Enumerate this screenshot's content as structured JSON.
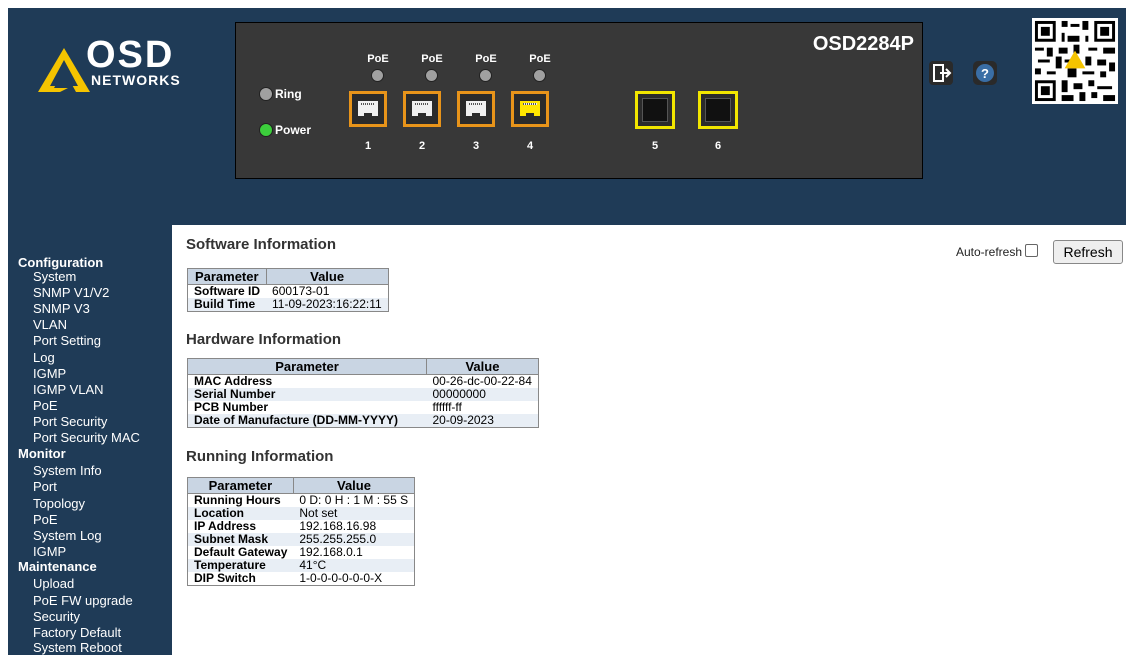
{
  "logo": {
    "main": "OSD",
    "sub": "NETWORKS"
  },
  "device": {
    "model": "OSD2284P",
    "leds": [
      {
        "label": "Ring",
        "state": "off",
        "color": "#a0a0a0"
      },
      {
        "label": "Power",
        "state": "on",
        "color": "#3ccf3c"
      }
    ],
    "poe_labels": [
      "PoE",
      "PoE",
      "PoE",
      "PoE"
    ],
    "ports": [
      {
        "number": "1",
        "type": "rj45",
        "link": false
      },
      {
        "number": "2",
        "type": "rj45",
        "link": false
      },
      {
        "number": "3",
        "type": "rj45",
        "link": false
      },
      {
        "number": "4",
        "type": "rj45",
        "link": true
      },
      {
        "number": "5",
        "type": "sfp",
        "link": false
      },
      {
        "number": "6",
        "type": "sfp",
        "link": false
      }
    ]
  },
  "header_icons": [
    "logout-icon",
    "help-icon",
    "qr-code-icon"
  ],
  "sidebar": {
    "groups": [
      {
        "title": "Configuration",
        "items": [
          "System",
          "SNMP V1/V2",
          "SNMP V3",
          "VLAN",
          "Port Setting",
          "Log",
          "IGMP",
          "IGMP VLAN",
          "PoE",
          "Port Security",
          "Port Security MAC"
        ]
      },
      {
        "title": "Monitor",
        "items": [
          "System Info",
          "Port",
          "Topology",
          "PoE",
          "System Log",
          "IGMP"
        ]
      },
      {
        "title": "Maintenance",
        "items": [
          "Upload",
          "PoE FW upgrade",
          "Security",
          "Factory Default",
          "System Reboot"
        ]
      }
    ]
  },
  "controls": {
    "auto_refresh_label": "Auto-refresh",
    "auto_refresh_checked": false,
    "refresh_label": "Refresh"
  },
  "software": {
    "title": "Software Information",
    "headers": [
      "Parameter",
      "Value"
    ],
    "rows": [
      [
        "Software ID",
        "600173-01"
      ],
      [
        "Build Time",
        "11-09-2023:16:22:11"
      ]
    ]
  },
  "hardware": {
    "title": "Hardware Information",
    "headers": [
      "Parameter",
      "Value"
    ],
    "rows": [
      [
        "MAC Address",
        "00-26-dc-00-22-84"
      ],
      [
        "Serial Number",
        "00000000"
      ],
      [
        "PCB Number",
        "ffffff-ff"
      ],
      [
        "Date of Manufacture (DD-MM-YYYY)",
        "20-09-2023"
      ]
    ]
  },
  "running": {
    "title": "Running Information",
    "headers": [
      "Parameter",
      "Value"
    ],
    "rows": [
      [
        "Running Hours",
        "0 D: 0 H : 1 M : 55 S"
      ],
      [
        "Location",
        "Not set"
      ],
      [
        "IP Address",
        "192.168.16.98"
      ],
      [
        "Subnet Mask",
        "255.255.255.0"
      ],
      [
        "Default Gateway",
        "192.168.0.1"
      ],
      [
        "Temperature",
        "41°C"
      ],
      [
        "DIP Switch",
        "1-0-0-0-0-0-0-X"
      ]
    ]
  },
  "colors": {
    "nav_bg": "#1f3b57",
    "panel_bg": "#383838",
    "rj45_border": "#e8941a",
    "sfp_border": "#f2e600",
    "logo_accent": "#f5c400",
    "table_header": "#c9d5e3"
  }
}
